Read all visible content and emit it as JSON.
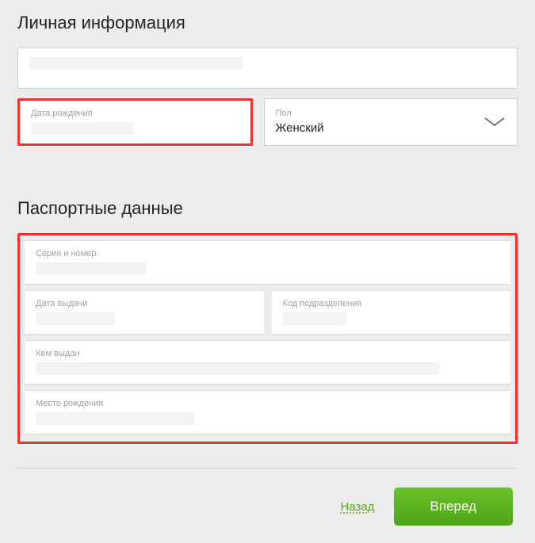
{
  "personal": {
    "title": "Личная информация",
    "dob_label": "Дата рождения",
    "gender_label": "Пол",
    "gender_value": "Женский"
  },
  "passport": {
    "title": "Паспортные данные",
    "series_label": "Серия и номер",
    "issue_date_label": "Дата выдачи",
    "department_code_label": "Код подразделения",
    "issued_by_label": "Кем выдан",
    "birthplace_label": "Место рождения"
  },
  "nav": {
    "back": "Назад",
    "forward": "Вперед"
  }
}
